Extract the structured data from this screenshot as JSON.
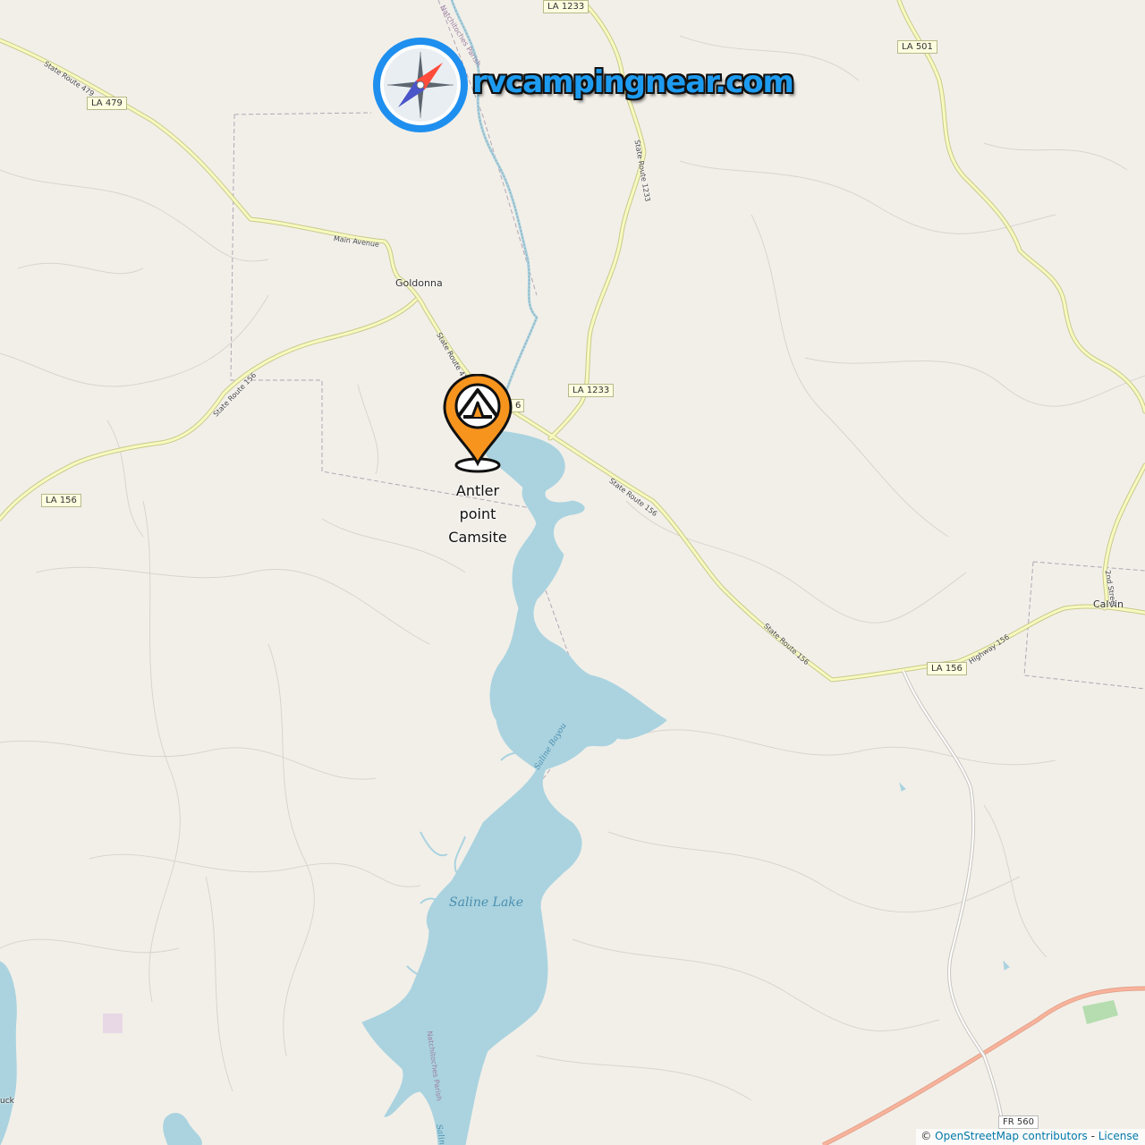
{
  "brand": {
    "name": "rvcampingnear.com",
    "logo_icon": "compass-icon"
  },
  "campsite": {
    "label_lines": [
      "Antler",
      "point",
      "Camsite"
    ],
    "icon": "tent-icon",
    "color": "#f7941d"
  },
  "places": {
    "goldonna": "Goldonna",
    "calvin": "Calvin"
  },
  "road_shields": {
    "la479": "LA 479",
    "la1233_top": "LA 1233",
    "la1233_mid": "LA 1233",
    "la501": "LA 501",
    "la156_west": "LA 156",
    "la156_east": "LA 156",
    "la156_partial": "6",
    "fr560": "FR 560"
  },
  "road_labels": {
    "sr479_top": "State Route 479",
    "main_avenue": "Main Avenue",
    "sr479_mid": "State Route 479",
    "sr1233": "State Route 1233",
    "sr156_west": "State Route 156",
    "sr156_mid": "State Route 156",
    "sr156_lower": "State Route 156",
    "highway156": "Highway 156",
    "second_street": "2nd Street"
  },
  "water_labels": {
    "saline_lake": "Saline Lake",
    "saline_bayou": "Saline Bayou",
    "saline_partial": "Saline"
  },
  "parish_labels": {
    "top": "Natchitoches Parish",
    "bottom": "Natchitoches Parish"
  },
  "partial_labels": {
    "left_edge": "uck"
  },
  "attribution": {
    "prefix": "©",
    "osm": "OpenStreetMap contributors",
    "sep": "-",
    "license": "License"
  },
  "colors": {
    "background": "#f2efe9",
    "water": "#aad3df",
    "road_secondary": "#f7fabf",
    "road_trunk": "#f9b29c",
    "brand_text": "#1d9bf0"
  }
}
